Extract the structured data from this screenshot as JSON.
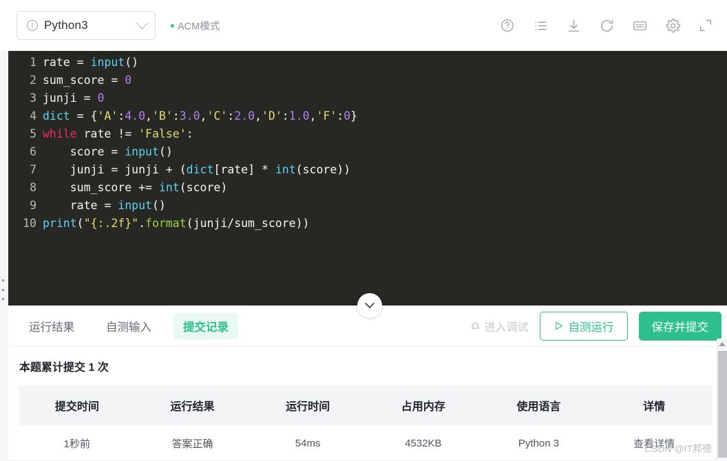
{
  "toolbar": {
    "language": "Python3",
    "language_icon": "info-circle-icon",
    "mode_label": "ACM模式",
    "icons": [
      {
        "name": "help-icon",
        "label": "帮助"
      },
      {
        "name": "list-icon",
        "label": "题目列表"
      },
      {
        "name": "download-icon",
        "label": "下载代码"
      },
      {
        "name": "refresh-icon",
        "label": "重置代码"
      },
      {
        "name": "shortcut-icon",
        "label": "快捷键"
      },
      {
        "name": "settings-icon",
        "label": "设置"
      },
      {
        "name": "expand-icon",
        "label": "全屏"
      }
    ]
  },
  "editor": {
    "lines": [
      {
        "n": "1",
        "tokens": [
          {
            "t": "rate ",
            "c": "def"
          },
          {
            "t": "= ",
            "c": "punct"
          },
          {
            "t": "input",
            "c": "fn"
          },
          {
            "t": "()",
            "c": "punct"
          }
        ]
      },
      {
        "n": "2",
        "tokens": [
          {
            "t": "sum_score ",
            "c": "def"
          },
          {
            "t": "= ",
            "c": "punct"
          },
          {
            "t": "0",
            "c": "num"
          }
        ]
      },
      {
        "n": "3",
        "tokens": [
          {
            "t": "junji ",
            "c": "def"
          },
          {
            "t": "= ",
            "c": "punct"
          },
          {
            "t": "0",
            "c": "num"
          }
        ]
      },
      {
        "n": "4",
        "tokens": [
          {
            "t": "dict ",
            "c": "fn"
          },
          {
            "t": "= {",
            "c": "punct"
          },
          {
            "t": "'A'",
            "c": "str"
          },
          {
            "t": ":",
            "c": "punct"
          },
          {
            "t": "4.0",
            "c": "num"
          },
          {
            "t": ",",
            "c": "punct"
          },
          {
            "t": "'B'",
            "c": "str"
          },
          {
            "t": ":",
            "c": "punct"
          },
          {
            "t": "3.0",
            "c": "num"
          },
          {
            "t": ",",
            "c": "punct"
          },
          {
            "t": "'C'",
            "c": "str"
          },
          {
            "t": ":",
            "c": "punct"
          },
          {
            "t": "2.0",
            "c": "num"
          },
          {
            "t": ",",
            "c": "punct"
          },
          {
            "t": "'D'",
            "c": "str"
          },
          {
            "t": ":",
            "c": "punct"
          },
          {
            "t": "1.0",
            "c": "num"
          },
          {
            "t": ",",
            "c": "punct"
          },
          {
            "t": "'F'",
            "c": "str"
          },
          {
            "t": ":",
            "c": "punct"
          },
          {
            "t": "0",
            "c": "num"
          },
          {
            "t": "}",
            "c": "punct"
          }
        ]
      },
      {
        "n": "5",
        "tokens": [
          {
            "t": "while ",
            "c": "kw"
          },
          {
            "t": "rate ",
            "c": "def"
          },
          {
            "t": "!= ",
            "c": "punct"
          },
          {
            "t": "'False'",
            "c": "str"
          },
          {
            "t": ":",
            "c": "punct"
          }
        ]
      },
      {
        "n": "6",
        "tokens": [
          {
            "t": "    score ",
            "c": "def"
          },
          {
            "t": "= ",
            "c": "punct"
          },
          {
            "t": "input",
            "c": "fn"
          },
          {
            "t": "()",
            "c": "punct"
          }
        ]
      },
      {
        "n": "7",
        "tokens": [
          {
            "t": "    junji ",
            "c": "def"
          },
          {
            "t": "= ",
            "c": "punct"
          },
          {
            "t": "junji ",
            "c": "def"
          },
          {
            "t": "+ (",
            "c": "punct"
          },
          {
            "t": "dict",
            "c": "fn"
          },
          {
            "t": "[",
            "c": "punct"
          },
          {
            "t": "rate",
            "c": "def"
          },
          {
            "t": "] * ",
            "c": "punct"
          },
          {
            "t": "int",
            "c": "fn"
          },
          {
            "t": "(",
            "c": "punct"
          },
          {
            "t": "score",
            "c": "def"
          },
          {
            "t": "))",
            "c": "punct"
          }
        ]
      },
      {
        "n": "8",
        "tokens": [
          {
            "t": "    sum_score ",
            "c": "def"
          },
          {
            "t": "+= ",
            "c": "punct"
          },
          {
            "t": "int",
            "c": "fn"
          },
          {
            "t": "(",
            "c": "punct"
          },
          {
            "t": "score",
            "c": "def"
          },
          {
            "t": ")",
            "c": "punct"
          }
        ]
      },
      {
        "n": "9",
        "tokens": [
          {
            "t": "    rate ",
            "c": "def"
          },
          {
            "t": "= ",
            "c": "punct"
          },
          {
            "t": "input",
            "c": "fn"
          },
          {
            "t": "()",
            "c": "punct"
          }
        ]
      },
      {
        "n": "10",
        "tokens": [
          {
            "t": "print",
            "c": "fn"
          },
          {
            "t": "(",
            "c": "punct"
          },
          {
            "t": "\"{:.2f}\"",
            "c": "str"
          },
          {
            "t": ".",
            "c": "punct"
          },
          {
            "t": "format",
            "c": "meth"
          },
          {
            "t": "(",
            "c": "punct"
          },
          {
            "t": "junji",
            "c": "def"
          },
          {
            "t": "/",
            "c": "punct"
          },
          {
            "t": "sum_score",
            "c": "def"
          },
          {
            "t": "))",
            "c": "punct"
          }
        ]
      }
    ],
    "collapse_icon": "chevron-down-icon",
    "drag_handle": "resize-handle"
  },
  "panel": {
    "tabs": [
      {
        "label": "运行结果",
        "active": false
      },
      {
        "label": "自测输入",
        "active": false
      },
      {
        "label": "提交记录",
        "active": true
      }
    ],
    "debug_button": "进入调试",
    "run_button": "自测运行",
    "submit_button": "保存并提交",
    "summary": "本题累计提交 1 次",
    "table": {
      "headers": [
        "提交时间",
        "运行结果",
        "运行时间",
        "占用内存",
        "使用语言",
        "详情"
      ],
      "rows": [
        {
          "time": "1秒前",
          "result": "答案正确",
          "runtime": "54ms",
          "memory": "4532KB",
          "language": "Python 3",
          "detail": "查看详情"
        }
      ]
    }
  },
  "watermark": "CSDN @IT邦德",
  "colors": {
    "accent_green": "#2ec08c",
    "editor_bg": "#272823",
    "panel_bg": "#ffffff",
    "page_bg": "#f5f6f8"
  }
}
